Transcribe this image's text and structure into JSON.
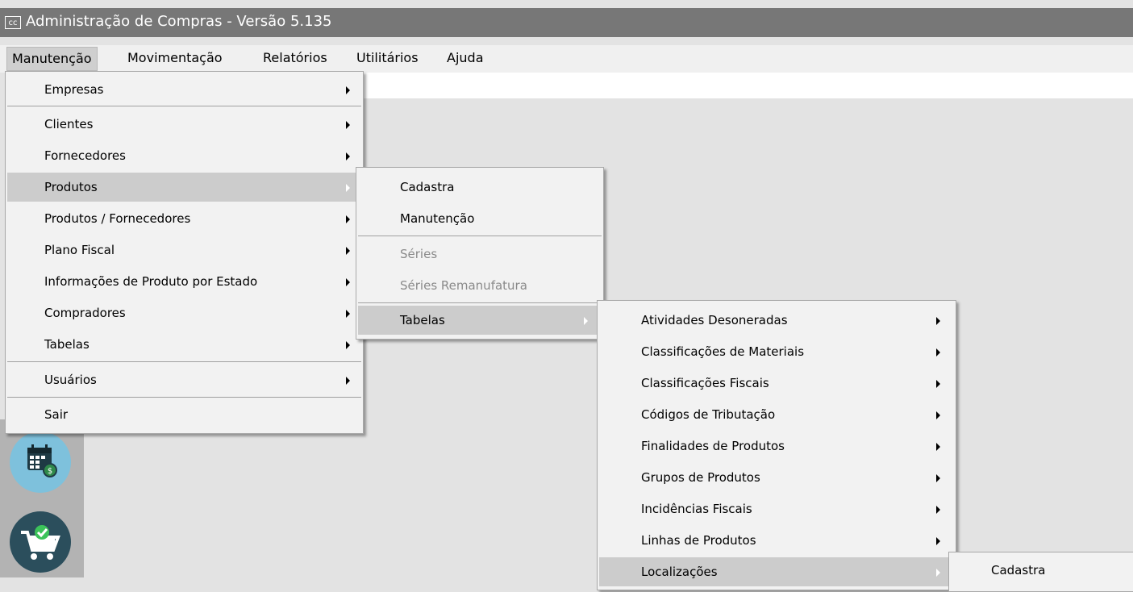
{
  "window": {
    "icon_text": "cc",
    "title": "Administração de Compras - Versão 5.135"
  },
  "menubar": [
    "Manutenção",
    "Movimentação",
    "Relatórios",
    "Utilitários",
    "Ajuda"
  ],
  "menu_manutencao": [
    "Empresas",
    "Clientes",
    "Fornecedores",
    "Produtos",
    "Produtos / Fornecedores",
    "Plano Fiscal",
    "Informações de Produto por Estado",
    "Compradores",
    "Tabelas",
    "Usuários",
    "Sair"
  ],
  "menu_produtos": [
    "Cadastra",
    "Manutenção",
    "Séries",
    "Séries Remanufatura",
    "Tabelas"
  ],
  "menu_tabelas": [
    "Atividades Desoneradas",
    "Classificações de Materiais",
    "Classificações Fiscais",
    "Códigos de Tributação",
    "Finalidades de Produtos",
    "Grupos de Produtos",
    "Incidências Fiscais",
    "Linhas de Produtos",
    "Localizações"
  ],
  "menu_localizacoes": [
    "Cadastra"
  ],
  "icons": {
    "left_1": "calendar-money-icon",
    "left_2": "shopping-cart-check-icon"
  },
  "colors": {
    "titlebar": "#777777",
    "highlight": "#cccccc",
    "calendar_circle": "#7ec1dc",
    "cart_circle": "#2b4e5c",
    "check_green": "#3cc35a"
  }
}
